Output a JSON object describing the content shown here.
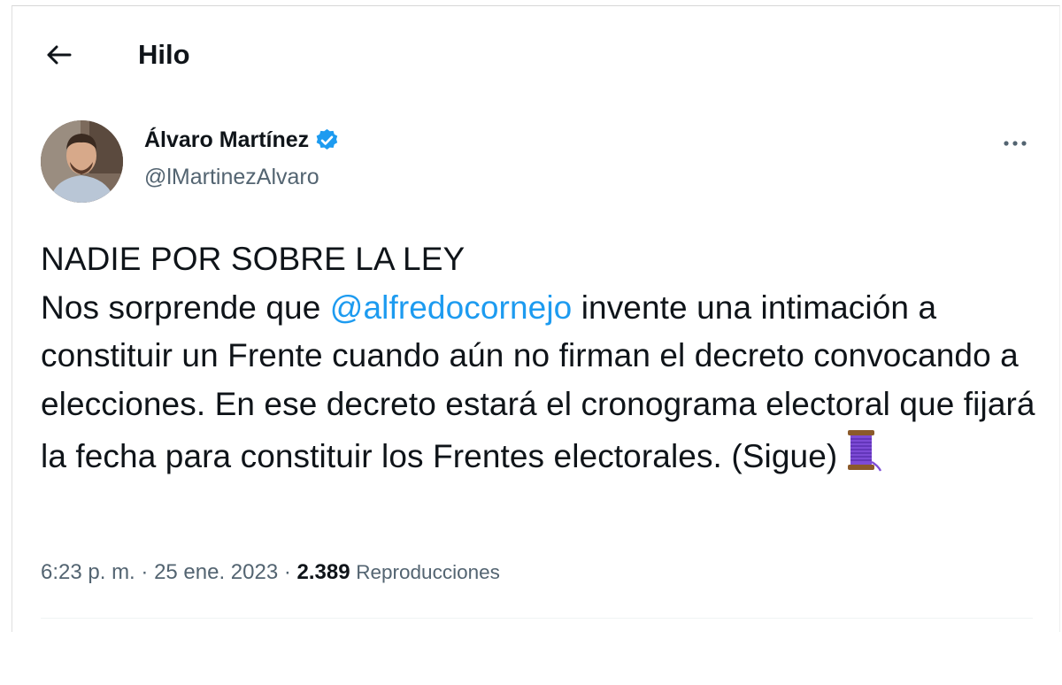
{
  "header": {
    "title": "Hilo",
    "back_icon": "arrow-left-icon"
  },
  "author": {
    "name": "Álvaro Martínez",
    "handle": "@lMartinezAlvaro",
    "verified_icon": "verified-badge-icon",
    "verified_color": "#1d9bf0"
  },
  "menu": {
    "more_icon": "more-horizontal-icon"
  },
  "tweet": {
    "line1": "NADIE POR SOBRE LA LEY",
    "text_before_mention": "Nos sorprende que ",
    "mention": "@alfredocornejo",
    "text_after_mention": " invente una intimación a constituir un Frente cuando aún no firman el decreto convocando a elecciones. En ese decreto estará el cronograma electoral que fijará la fecha para constituir los Frentes electorales. (Sigue)",
    "emoji": "🧵",
    "emoji_icon": "thread-spool-icon"
  },
  "meta": {
    "time": "6:23 p. m.",
    "separator": " · ",
    "date": "25 ene. 2023",
    "views_count": "2.389",
    "views_label": "Reproducciones"
  },
  "colors": {
    "text": "#0f1419",
    "secondary": "#536471",
    "link": "#1d9bf0"
  }
}
